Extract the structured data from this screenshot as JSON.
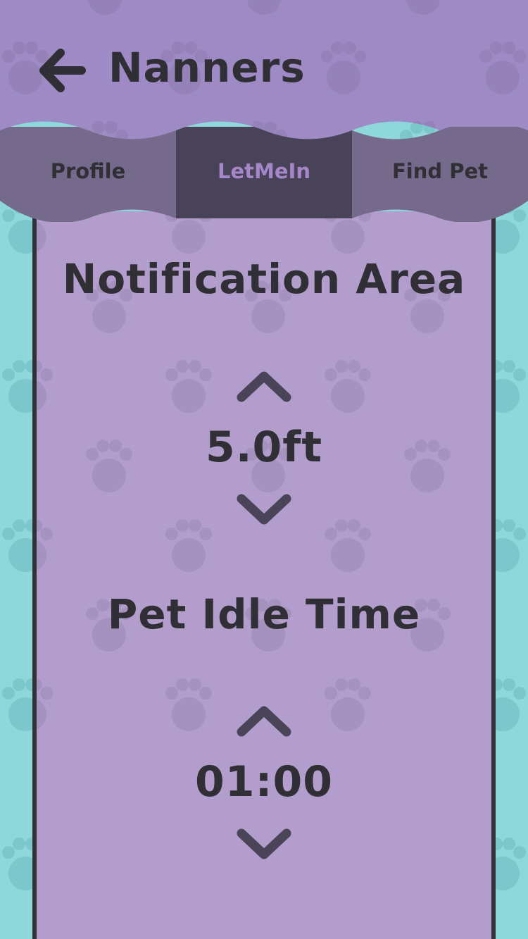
{
  "header": {
    "back_icon": "arrow-left-icon",
    "title": "Nanners"
  },
  "tabs": [
    {
      "label": "Profile",
      "active": false
    },
    {
      "label": "LetMeIn",
      "active": true
    },
    {
      "label": "Find Pet",
      "active": false
    }
  ],
  "notification": {
    "title": "Notification Area",
    "value": "5.0ft",
    "up_icon": "chevron-up-icon",
    "down_icon": "chevron-down-icon"
  },
  "idle": {
    "title": "Pet Idle Time",
    "value": "01:00",
    "up_icon": "chevron-up-icon",
    "down_icon": "chevron-down-icon"
  },
  "colors": {
    "header_purple": "#9e8ac4",
    "panel_purple": "#b29dcc",
    "tab_gray": "#756a8c",
    "tab_active": "#49435a",
    "teal": "#8ed8dc",
    "text_dark": "#2f2f35",
    "icon_dark": "#4a4458"
  }
}
